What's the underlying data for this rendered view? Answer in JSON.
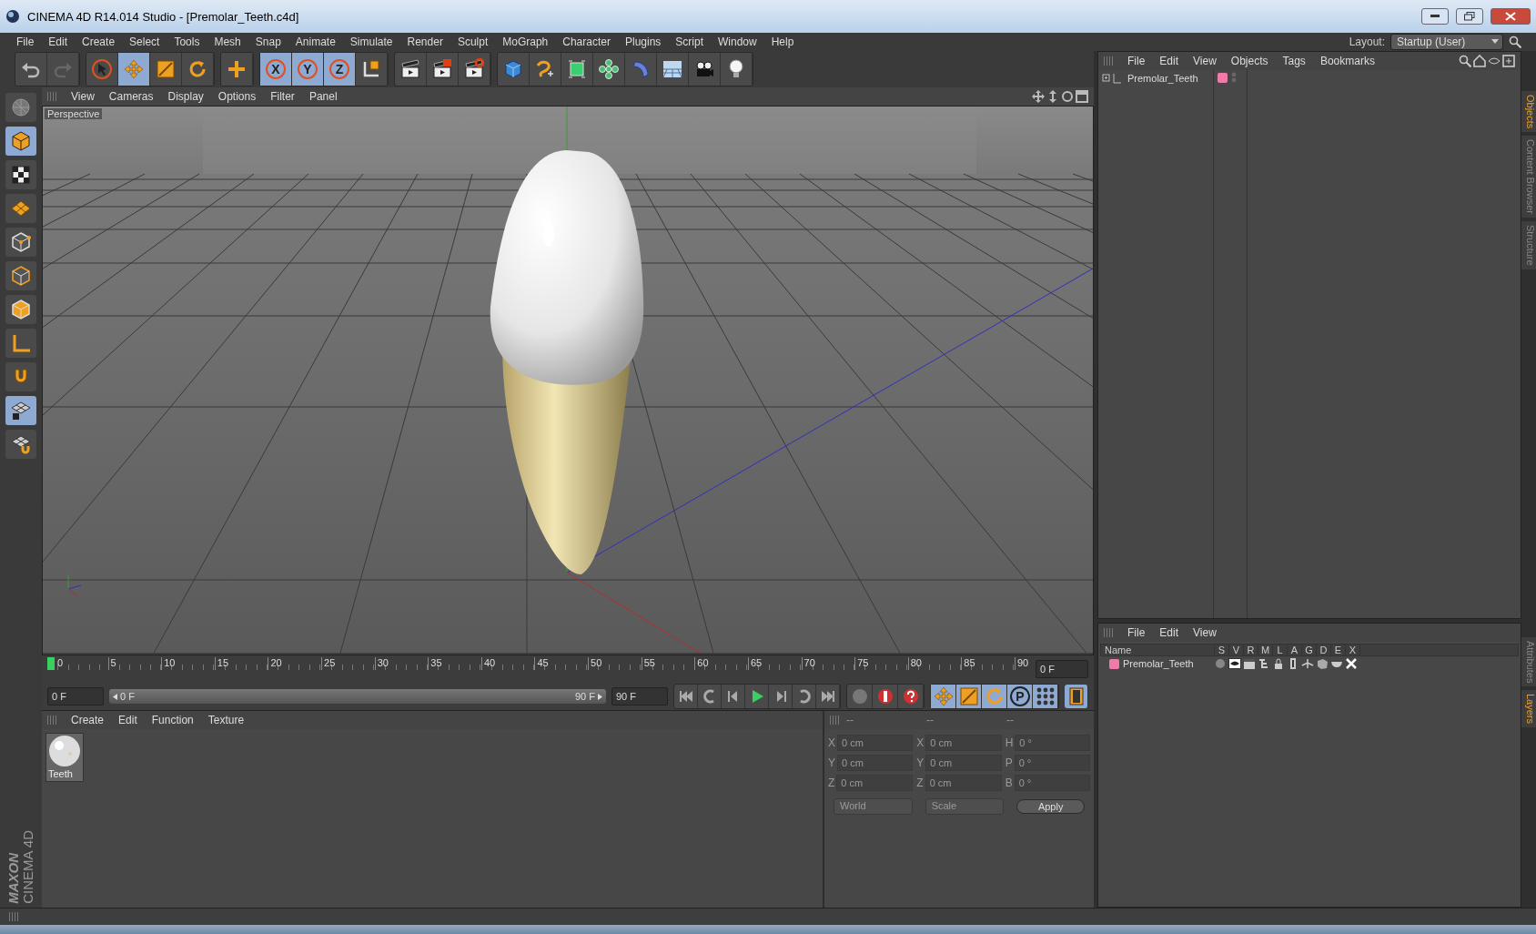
{
  "window": {
    "title": "CINEMA 4D R14.014 Studio - [Premolar_Teeth.c4d]"
  },
  "menu": [
    "File",
    "Edit",
    "Create",
    "Select",
    "Tools",
    "Mesh",
    "Snap",
    "Animate",
    "Simulate",
    "Render",
    "Sculpt",
    "MoGraph",
    "Character",
    "Plugins",
    "Script",
    "Window",
    "Help"
  ],
  "layout": {
    "label": "Layout:",
    "value": "Startup (User)"
  },
  "toolbar": [
    [
      {
        "kind": "undo",
        "selected": false
      },
      {
        "kind": "redo",
        "selected": false
      }
    ],
    [
      {
        "kind": "select",
        "selected": false
      },
      {
        "kind": "move",
        "selected": true
      },
      {
        "kind": "scale",
        "selected": false
      },
      {
        "kind": "rotate",
        "selected": false
      }
    ],
    [
      {
        "kind": "add",
        "selected": false
      }
    ],
    [
      {
        "kind": "axis",
        "label": "X",
        "selected": true
      },
      {
        "kind": "axis",
        "label": "Y",
        "selected": true
      },
      {
        "kind": "axis",
        "label": "Z",
        "selected": true
      },
      {
        "kind": "coords",
        "selected": false
      }
    ],
    [
      {
        "kind": "render-view",
        "selected": false
      },
      {
        "kind": "render-picture",
        "selected": false
      },
      {
        "kind": "render-settings",
        "selected": false
      }
    ],
    [
      {
        "kind": "cube",
        "selected": false
      },
      {
        "kind": "spline",
        "selected": false
      },
      {
        "kind": "nurbs",
        "selected": false
      },
      {
        "kind": "array",
        "selected": false
      },
      {
        "kind": "deformer",
        "selected": false
      },
      {
        "kind": "floor",
        "selected": false
      },
      {
        "kind": "camera",
        "selected": false
      },
      {
        "kind": "light",
        "selected": false
      }
    ]
  ],
  "left_tools": [
    {
      "kind": "editable",
      "selected": false
    },
    {
      "kind": "model",
      "selected": true
    },
    {
      "kind": "texture",
      "selected": false
    },
    {
      "kind": "workplane",
      "selected": false
    },
    {
      "kind": "points",
      "selected": false
    },
    {
      "kind": "edges",
      "selected": false
    },
    {
      "kind": "polygons",
      "selected": false
    },
    {
      "kind": "axis-tool",
      "selected": false
    },
    {
      "kind": "magnet",
      "selected": false
    },
    {
      "kind": "grid-snap",
      "selected": true
    },
    {
      "kind": "grid-lock",
      "selected": false
    }
  ],
  "branding": {
    "company": "MAXON",
    "product": "CINEMA 4D"
  },
  "viewport": {
    "menu": [
      "View",
      "Cameras",
      "Display",
      "Options",
      "Filter",
      "Panel"
    ],
    "label": "Perspective"
  },
  "timeline": {
    "ticks": [
      "0",
      "5",
      "10",
      "15",
      "20",
      "25",
      "30",
      "35",
      "40",
      "45",
      "50",
      "55",
      "60",
      "65",
      "70",
      "75",
      "80",
      "85",
      "90"
    ],
    "frame": "0 F",
    "start": "0 F",
    "range": {
      "start": "0 F",
      "end": "90 F"
    },
    "end": "90 F"
  },
  "key_tools": [
    {
      "kind": "move",
      "selected": true
    },
    {
      "kind": "scale",
      "selected": true
    },
    {
      "kind": "rotate",
      "selected": true
    },
    {
      "kind": "param",
      "label": "P",
      "selected": true
    },
    {
      "kind": "dots",
      "selected": true
    }
  ],
  "materials": {
    "menu": [
      "Create",
      "Edit",
      "Function",
      "Texture"
    ],
    "items": [
      {
        "name": "Teeth"
      }
    ]
  },
  "coordinates": {
    "disabled": true,
    "headers": [
      "--",
      "--",
      "--"
    ],
    "rows": [
      {
        "cells": [
          {
            "axis": "X",
            "value": "0 cm"
          },
          {
            "axis": "X",
            "value": "0 cm"
          },
          {
            "axis": "H",
            "value": "0 °"
          }
        ]
      },
      {
        "cells": [
          {
            "axis": "Y",
            "value": "0 cm"
          },
          {
            "axis": "Y",
            "value": "0 cm"
          },
          {
            "axis": "P",
            "value": "0 °"
          }
        ]
      },
      {
        "cells": [
          {
            "axis": "Z",
            "value": "0 cm"
          },
          {
            "axis": "Z",
            "value": "0 cm"
          },
          {
            "axis": "B",
            "value": "0 °"
          }
        ]
      }
    ],
    "mode": "World",
    "size_mode": "Scale",
    "apply": "Apply"
  },
  "objects": {
    "menu": [
      "File",
      "Edit",
      "View",
      "Objects",
      "Tags",
      "Bookmarks"
    ],
    "items": [
      {
        "name": "Premolar_Teeth",
        "color": "#f07aa8"
      }
    ]
  },
  "layers": {
    "menu": [
      "File",
      "Edit",
      "View"
    ],
    "columns": [
      "Name",
      "S",
      "V",
      "R",
      "M",
      "L",
      "A",
      "G",
      "D",
      "E",
      "X"
    ],
    "rows": [
      {
        "name": "Premolar_Teeth",
        "color": "#f07aa8"
      }
    ]
  },
  "side_tabs": [
    {
      "label": "Objects",
      "selected": true
    },
    {
      "label": "Content Browser",
      "selected": false
    },
    {
      "label": "Structure",
      "selected": false
    },
    {
      "label": "Attributes",
      "selected": false
    },
    {
      "label": "Layers",
      "selected": true
    }
  ]
}
